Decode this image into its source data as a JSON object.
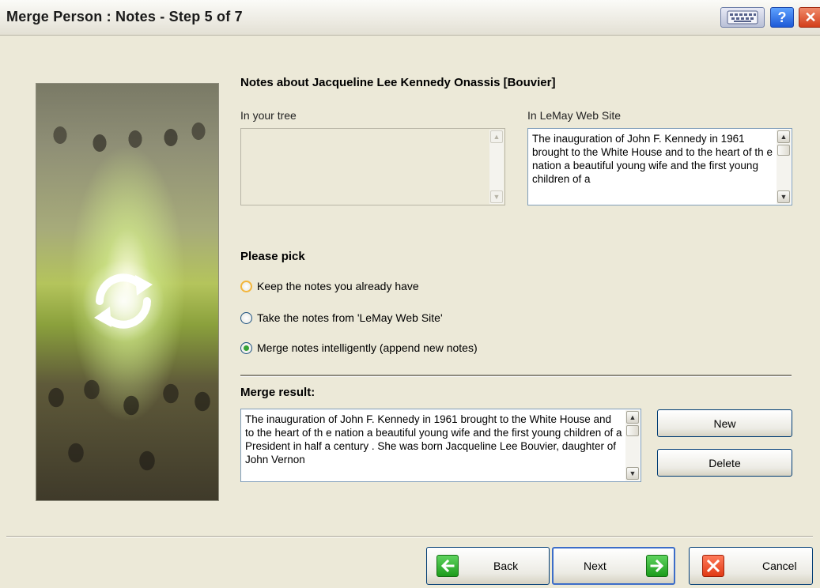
{
  "window": {
    "title": "Merge Person : Notes - Step 5 of 7",
    "help_glyph": "?",
    "close_glyph": "✕"
  },
  "notes": {
    "heading": "Notes about Jacqueline Lee Kennedy Onassis [Bouvier]",
    "left_label": "In your tree",
    "left_text": "",
    "right_label": "In LeMay Web Site",
    "right_text": "The inauguration of John F. Kennedy in 1961 brought to the White House and to the heart of th e nation a beautiful young wife and the first young children of a"
  },
  "pick": {
    "heading": "Please pick",
    "options": [
      {
        "label": "Keep the notes you already have",
        "checked": false
      },
      {
        "label": "Take the notes from 'LeMay Web Site'",
        "checked": false
      },
      {
        "label": "Merge notes intelligently (append new notes)",
        "checked": true
      }
    ]
  },
  "merge": {
    "heading": "Merge result:",
    "text": "The inauguration of John F. Kennedy in 1961 brought to the White House and to the heart of th e nation a beautiful young wife and the first young children of a President in half a century . She was born Jacqueline Lee Bouvier, daughter of John Vernon",
    "new_label": "New",
    "delete_label": "Delete"
  },
  "nav": {
    "back_label": "Back",
    "next_label": "Next",
    "cancel_label": "Cancel"
  },
  "icons": {
    "keyboard": "keyboard-icon",
    "help": "help-icon",
    "close": "close-icon",
    "back": "arrow-left-icon",
    "next": "arrow-right-icon",
    "cancel": "x-icon",
    "sync": "sync-arrows-icon"
  },
  "colors": {
    "window_bg": "#ece9d8",
    "accent_green": "#1c9c1c",
    "accent_red": "#e03a15",
    "radio_hover": "#f3b53a"
  }
}
